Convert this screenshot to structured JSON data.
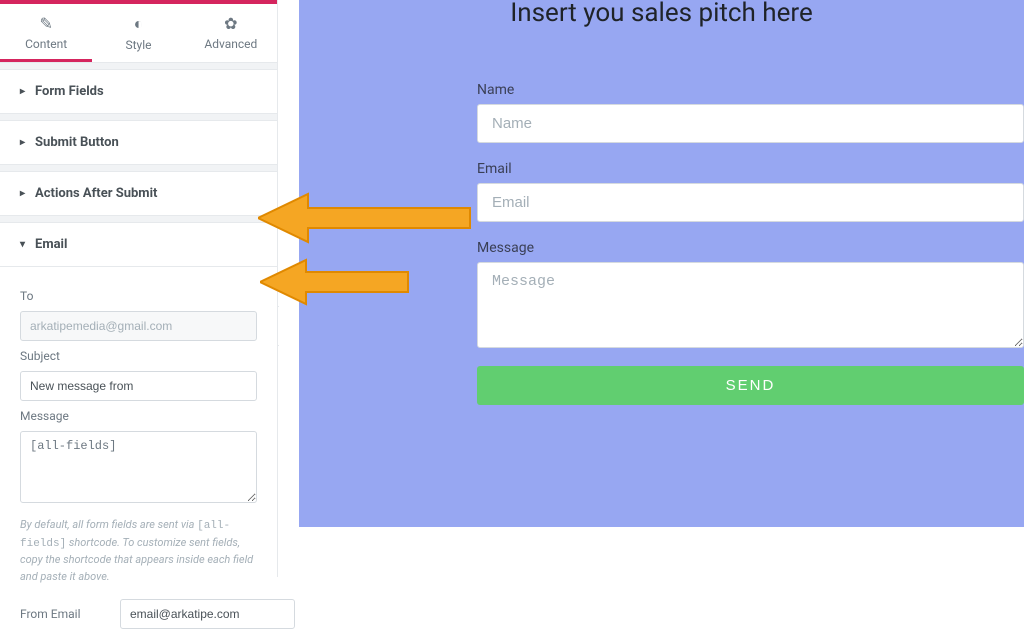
{
  "tabs": {
    "content": "Content",
    "style": "Style",
    "advanced": "Advanced"
  },
  "sections": {
    "form_fields": "Form Fields",
    "submit_button": "Submit Button",
    "actions_after_submit": "Actions After Submit",
    "email": "Email"
  },
  "email_panel": {
    "to_label": "To",
    "to_value": "arkatipemedia@gmail.com",
    "subject_label": "Subject",
    "subject_value": "New message from",
    "message_label": "Message",
    "message_value": "[all-fields]",
    "help_prefix": "By default, all form fields are sent via ",
    "help_code": "[all-fields]",
    "help_suffix": " shortcode. To customize sent fields, copy the shortcode that appears inside each field and paste it above.",
    "from_email_label": "From Email",
    "from_email_value": "email@arkatipe.com"
  },
  "canvas": {
    "hero_title": "Insert you sales pitch here",
    "name_label": "Name",
    "name_placeholder": "Name",
    "email_label": "Email",
    "email_placeholder": "Email",
    "message_label": "Message",
    "message_placeholder": "Message",
    "send_label": "SEND"
  },
  "collapse_caret": "‹"
}
